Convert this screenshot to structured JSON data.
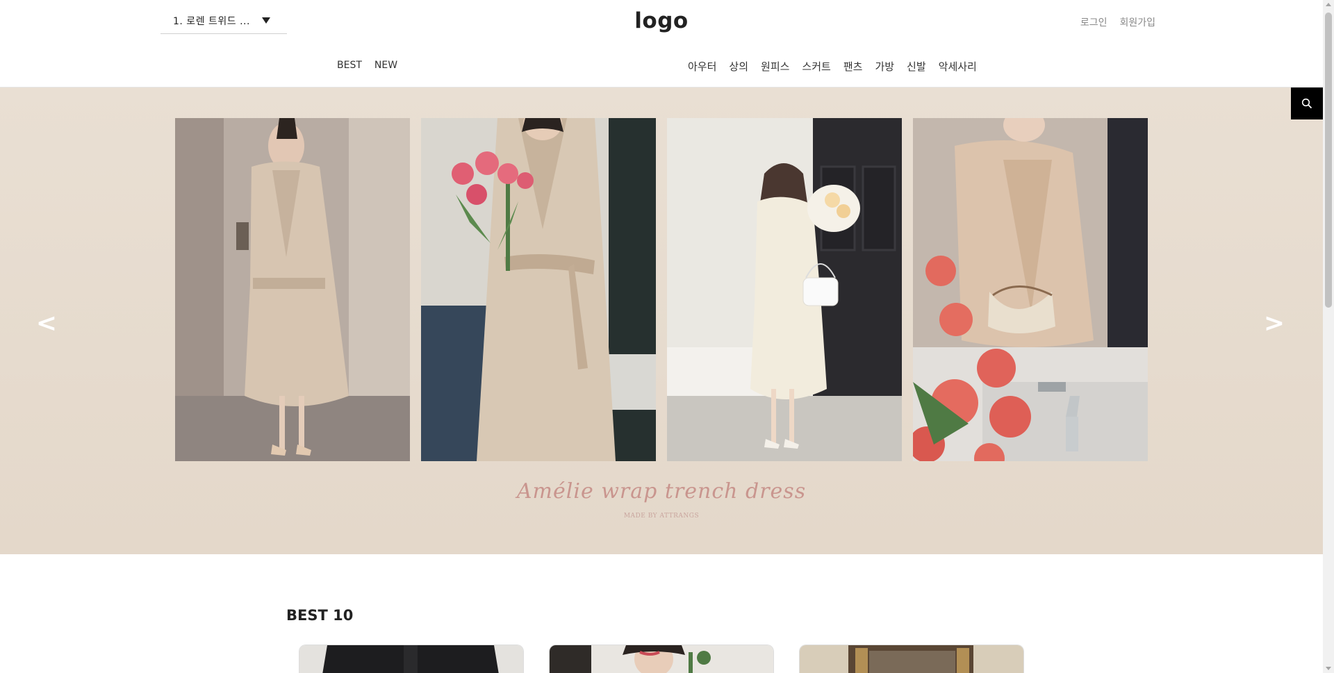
{
  "header": {
    "rank_select": "1. 로렌 트위드 ...",
    "logo": "logo",
    "user_links": [
      "로그인",
      "회원가입"
    ],
    "nav_left": [
      "BEST",
      "NEW"
    ],
    "nav_categories": [
      "아우터",
      "상의",
      "원피스",
      "스커트",
      "팬츠",
      "가방",
      "신발",
      "악세사리"
    ]
  },
  "banner": {
    "title": "Amélie  wrap trench dress",
    "subtitle": "MADE BY ATTRANGS",
    "prev_arrow": "<",
    "next_arrow": ">"
  },
  "best": {
    "title": "BEST 10"
  },
  "colors": {
    "banner_bg": "#e8ddd0",
    "title_pink": "#c9958e",
    "search_bg": "#000000"
  },
  "icons": {
    "search": "search-icon",
    "dropdown": "caret-down-icon"
  }
}
